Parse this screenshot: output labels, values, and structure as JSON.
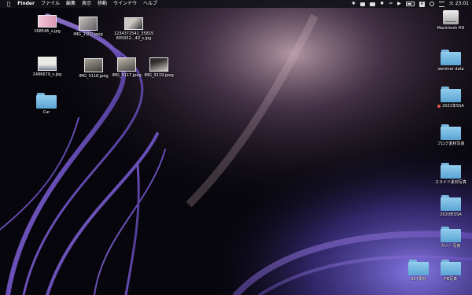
{
  "menubar": {
    "app_name": "Finder",
    "menus": [
      "ファイル",
      "編集",
      "表示",
      "移動",
      "ウインドウ",
      "ヘルプ"
    ],
    "time": "火 23:01",
    "status_icons": [
      "dropbox-icon",
      "message-icon",
      "screen-mirror-icon",
      "bluetooth-icon",
      "wifi-icon",
      "volume-icon",
      "battery-icon",
      "input-source-icon",
      "spotlight-icon",
      "control-center-icon"
    ],
    "input_source": "A"
  },
  "files": [
    {
      "name": "168546_s.jpg",
      "kind": "photo",
      "colors": [
        "#f3c6d6",
        "#d998b3"
      ]
    },
    {
      "name": "IMG_1302.jpeg",
      "kind": "photo",
      "colors": [
        "#5e5a63",
        "#c8c4bd"
      ]
    },
    {
      "name": "1234372541_35815\n805052...40_s.jpg",
      "kind": "photo",
      "colors": [
        "#c9c7c2",
        "#2b2b30"
      ]
    },
    {
      "name": "2486679_s.jpg",
      "kind": "photo",
      "colors": [
        "#e8e8e4",
        "#7a8391"
      ]
    },
    {
      "name": "IMG_9118.jpeg",
      "kind": "photo",
      "colors": [
        "#a8a196",
        "#3f3c3a"
      ]
    },
    {
      "name": "IMG_9117.jpeg",
      "kind": "photo",
      "colors": [
        "#bdb7ab",
        "#4a4641"
      ]
    },
    {
      "name": "IMG_9119.jpeg",
      "kind": "photo",
      "colors": [
        "#2f2d2b",
        "#d2cdc4"
      ]
    },
    {
      "name": "Car",
      "kind": "folder"
    }
  ],
  "right_items": [
    {
      "name": "Macintosh HD",
      "kind": "disk"
    },
    {
      "name": "seminar data",
      "kind": "folder"
    },
    {
      "name": "2021年SSA",
      "kind": "folder",
      "tag": "red"
    },
    {
      "name": "ブログ素材写真",
      "kind": "folder"
    },
    {
      "name": "スライド素材写真",
      "kind": "folder"
    },
    {
      "name": "2020年SSA",
      "kind": "folder"
    },
    {
      "name": "カバー写真",
      "kind": "folder"
    },
    {
      "name": "007素材",
      "kind": "folder"
    },
    {
      "name": "FB写真",
      "kind": "folder"
    }
  ],
  "colors": {
    "menubar_bg": "#121218",
    "folder_blue": "#6fb6e3",
    "tag_red": "#e8564e",
    "wallpaper_purple": "#6b4fb5"
  }
}
